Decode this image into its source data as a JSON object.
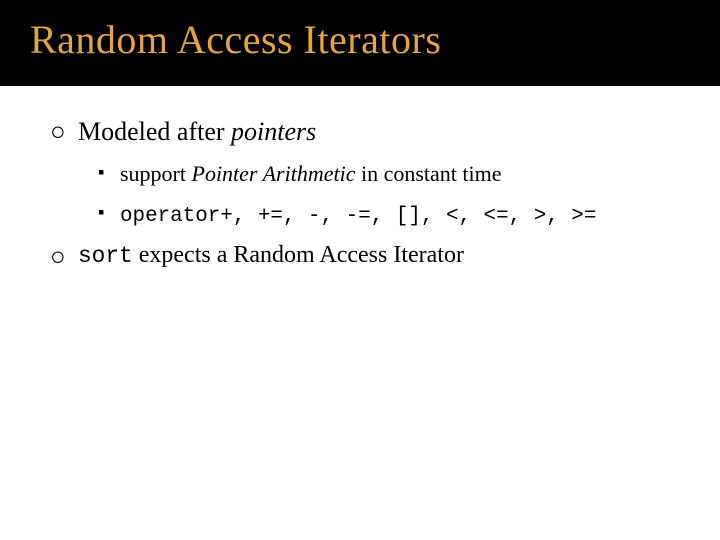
{
  "title": "Random Access Iterators",
  "bullets": {
    "b1_pre": "Modeled after ",
    "b1_italic": "pointers",
    "b1a_pre": "support ",
    "b1a_italic": "Pointer Arithmetic",
    "b1a_post": " in constant time",
    "b1b_code": "operator+, +=, -, -=, [], <, <=, >, >=",
    "b2_code": "sort",
    "b2_post": " expects a Random Access Iterator"
  },
  "glyphs": {
    "circle": "○",
    "square": "▪"
  }
}
